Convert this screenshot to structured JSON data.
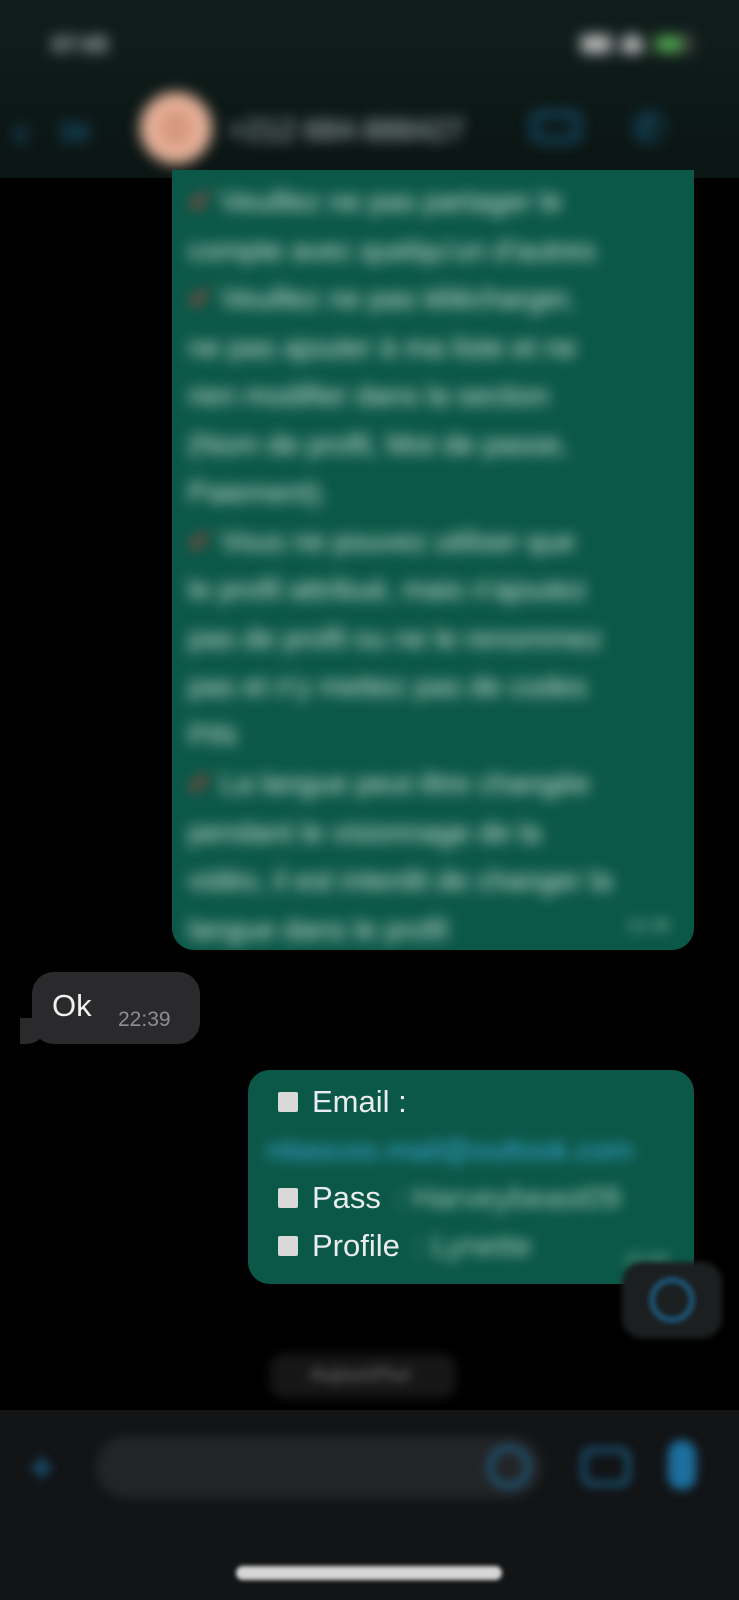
{
  "status_bar": {
    "time": "07:05"
  },
  "header": {
    "back_count": "58",
    "contact_name": "+212 684-888427"
  },
  "messages": {
    "outgoing_long": {
      "lines": [
        "✔ Veuillez ne pas partager le",
        "compte avec quelqu'un d'autres",
        "✔ Veuillez ne pas télécharger,",
        "ne pas ajouter à ma liste et ne",
        "rien modifier dans la section",
        "(Nom de profil, Mot de passe,",
        "Paiement).",
        "✔ Vous ne pouvez utiliser que",
        "le profil attribué, mais n'ajoutez",
        "pas de profil ou ne le renommez",
        "pas et n'y mettez pas de codes",
        "PIN",
        "✔ La langue peut être changée",
        "pendant le visionnage de la",
        "vidéo, il est interdit de changer la",
        "langue dans le profil"
      ],
      "time": "22:38"
    },
    "incoming": {
      "text": "Ok",
      "time": "22:39"
    },
    "outgoing_credentials": {
      "email_label": "Email :",
      "email_value": "nitascoo.mail@outlook.com",
      "pass_label": "Pass",
      "pass_value": ": Harveybeast09",
      "profile_label": "Profile",
      "profile_value": ": Lynette",
      "time": "22:40"
    }
  },
  "date_pill": "Aujourd'hui",
  "colors": {
    "accent": "#1d6f9e",
    "outgoing_bubble": "#0c5848",
    "incoming_bubble": "#2a2a2c"
  }
}
